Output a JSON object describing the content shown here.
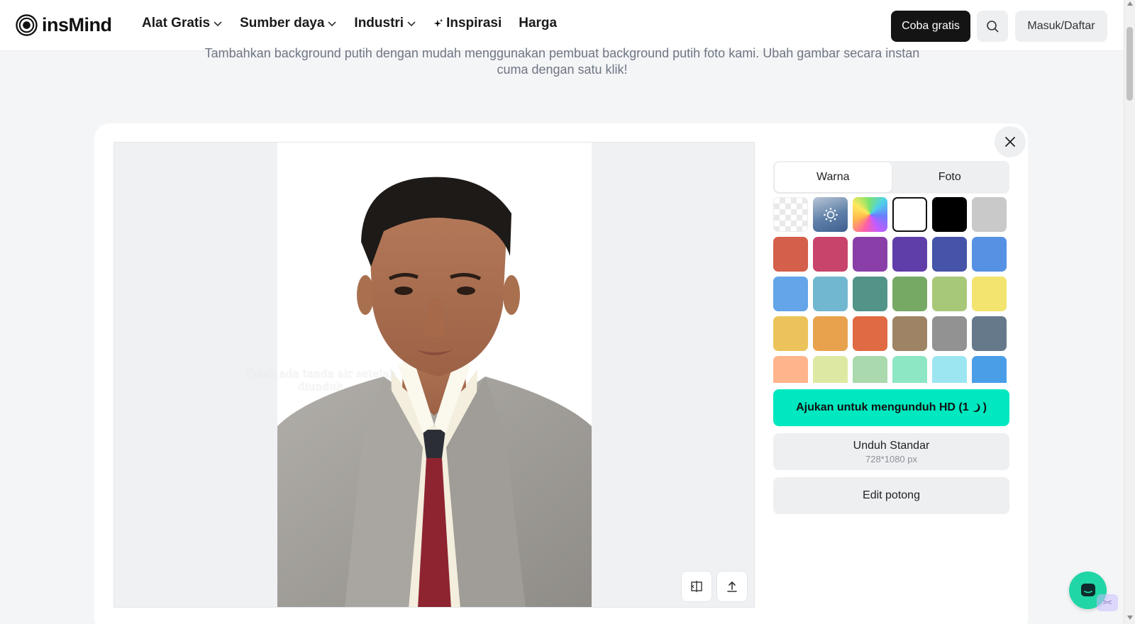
{
  "header": {
    "logo_text": "insMind",
    "nav": [
      {
        "label": "Alat Gratis",
        "has_dropdown": true
      },
      {
        "label": "Sumber daya",
        "has_dropdown": true
      },
      {
        "label": "Industri",
        "has_dropdown": true
      },
      {
        "label": "Inspirasi",
        "has_dropdown": false,
        "icon": "sparkle-icon"
      },
      {
        "label": "Harga",
        "has_dropdown": false
      }
    ],
    "try_free_label": "Coba gratis",
    "login_label": "Masuk/Daftar"
  },
  "intro_text": "Tambahkan background putih dengan mudah menggunakan pembuat background putih foto kami. Ubah gambar secara instan cuma dengan satu klik!",
  "editor": {
    "watermark_text": "Tidak ada tanda air setelah diunduh",
    "tabs": [
      {
        "label": "Warna",
        "active": true
      },
      {
        "label": "Foto",
        "active": false
      }
    ],
    "selected_color": "#ffffff",
    "swatches": [
      "transparent",
      "auto",
      "rainbow",
      "#ffffff",
      "#000000",
      "#c9c9c9",
      "#d45f4a",
      "#c9446a",
      "#8a3fa8",
      "#603eaa",
      "#4553a8",
      "#5691e3",
      "#63a5e8",
      "#72b7d0",
      "#529488",
      "#76aa64",
      "#a8c879",
      "#f2e46e",
      "#ebc35a",
      "#e8a24d",
      "#e06a43",
      "#9e8464",
      "#929292",
      "#66798a",
      "#ffb48c",
      "#dde9a2",
      "#a9d9ac",
      "#8de6c4",
      "#9ce6f2",
      "#4a9ee8"
    ],
    "hd_button_label": "Ajukan untuk mengunduh HD (1",
    "hd_button_suffix": ")",
    "standard_label": "Unduh Standar",
    "standard_size": "728*1080 px",
    "crop_label": "Edit potong"
  }
}
